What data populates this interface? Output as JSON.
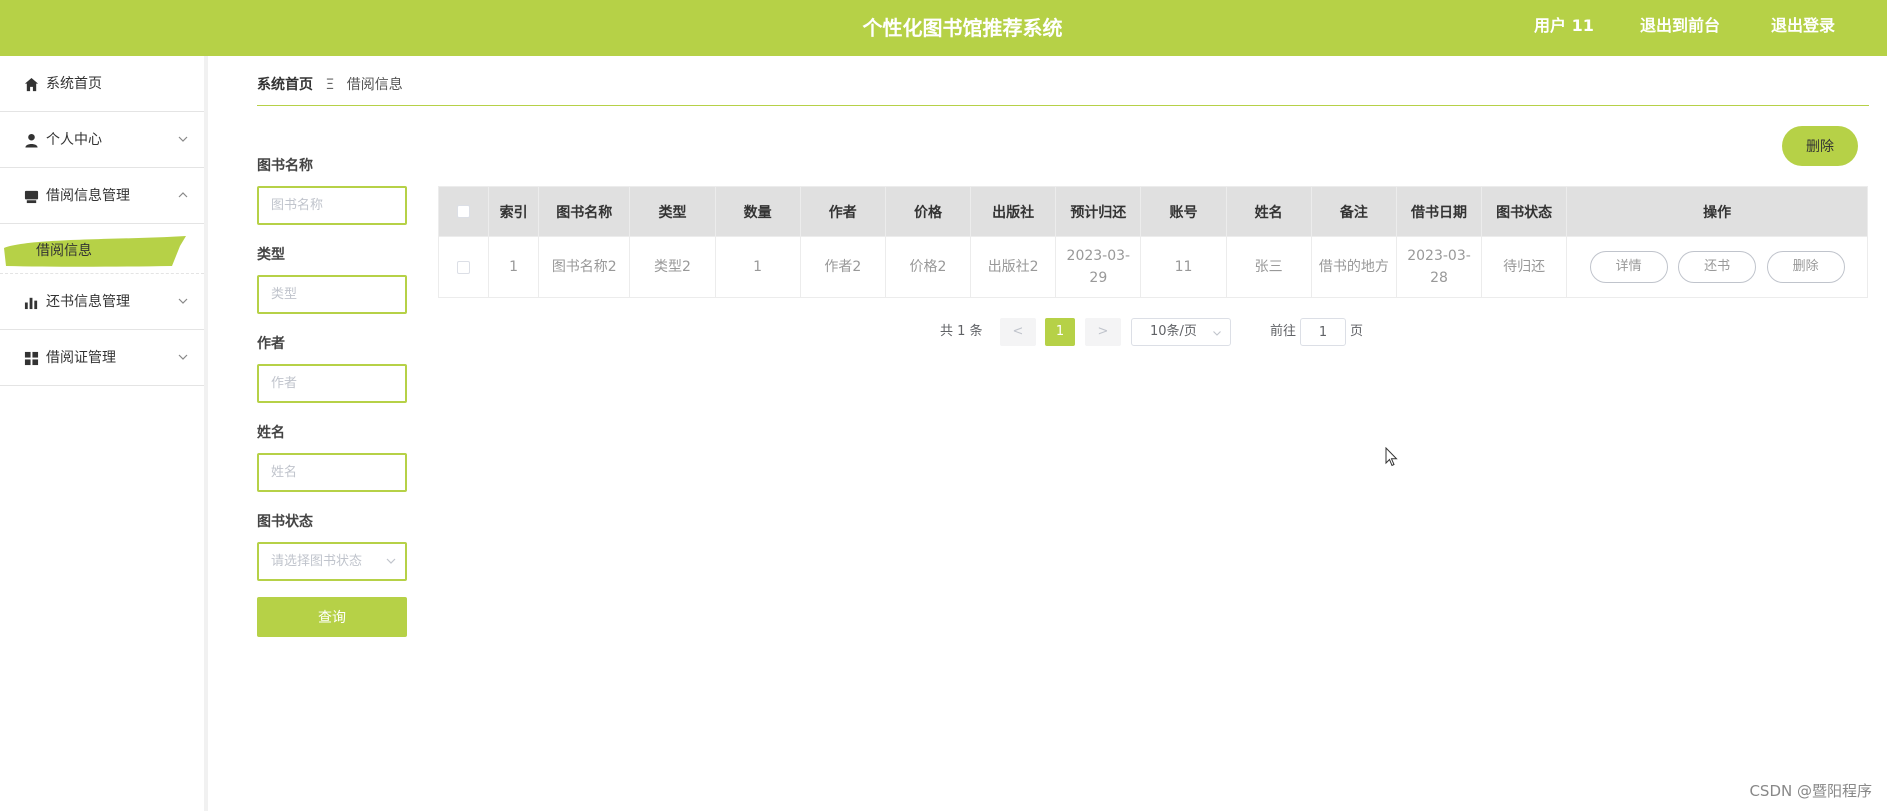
{
  "header": {
    "title": "个性化图书馆推荐系统",
    "user": "用户 11",
    "back_to_admin": "退出到前台",
    "logout": "退出登录"
  },
  "sidebar": {
    "items": [
      {
        "label": "系统首页",
        "icon": "home-icon"
      },
      {
        "label": "个人中心",
        "icon": "user-icon"
      },
      {
        "label": "借阅信息管理",
        "icon": "book-icon"
      },
      {
        "label": "还书信息管理",
        "icon": "bar-chart-icon"
      },
      {
        "label": "借阅证管理",
        "icon": "grid-icon"
      }
    ],
    "submenu_active": "借阅信息"
  },
  "breadcrumb": {
    "home": "系统首页",
    "separator": "Ξ",
    "current": "借阅信息"
  },
  "search": {
    "book_name_label": "图书名称",
    "book_name_placeholder": "图书名称",
    "type_label": "类型",
    "type_placeholder": "类型",
    "author_label": "作者",
    "author_placeholder": "作者",
    "name_label": "姓名",
    "name_placeholder": "姓名",
    "status_label": "图书状态",
    "status_placeholder": "请选择图书状态",
    "search_button": "查询"
  },
  "actions": {
    "delete": "删除"
  },
  "table": {
    "columns": [
      "索引",
      "图书名称",
      "类型",
      "数量",
      "作者",
      "价格",
      "出版社",
      "预计归还",
      "账号",
      "姓名",
      "备注",
      "借书日期",
      "图书状态",
      "操作"
    ],
    "rows": [
      {
        "index": "1",
        "book_name": "图书名称2",
        "type": "类型2",
        "quantity": "1",
        "author": "作者2",
        "price": "价格2",
        "publisher": "出版社2",
        "due_date": "2023-03-29",
        "account": "11",
        "name": "张三",
        "remark": "借书的地方",
        "borrow_date": "2023-03-28",
        "status": "待归还",
        "ops": {
          "detail": "详情",
          "return": "还书",
          "delete": "删除"
        }
      }
    ]
  },
  "pagination": {
    "total": "共 1 条",
    "prev": "<",
    "current_page": "1",
    "next": ">",
    "page_size": "10条/页",
    "goto_label": "前往",
    "goto_value": "1",
    "page_label": "页"
  },
  "watermark": "CSDN @暨阳程序",
  "colors": {
    "accent": "#b6d147",
    "header_bg": "#b6d147",
    "table_header_bg": "#e0e0e0"
  }
}
